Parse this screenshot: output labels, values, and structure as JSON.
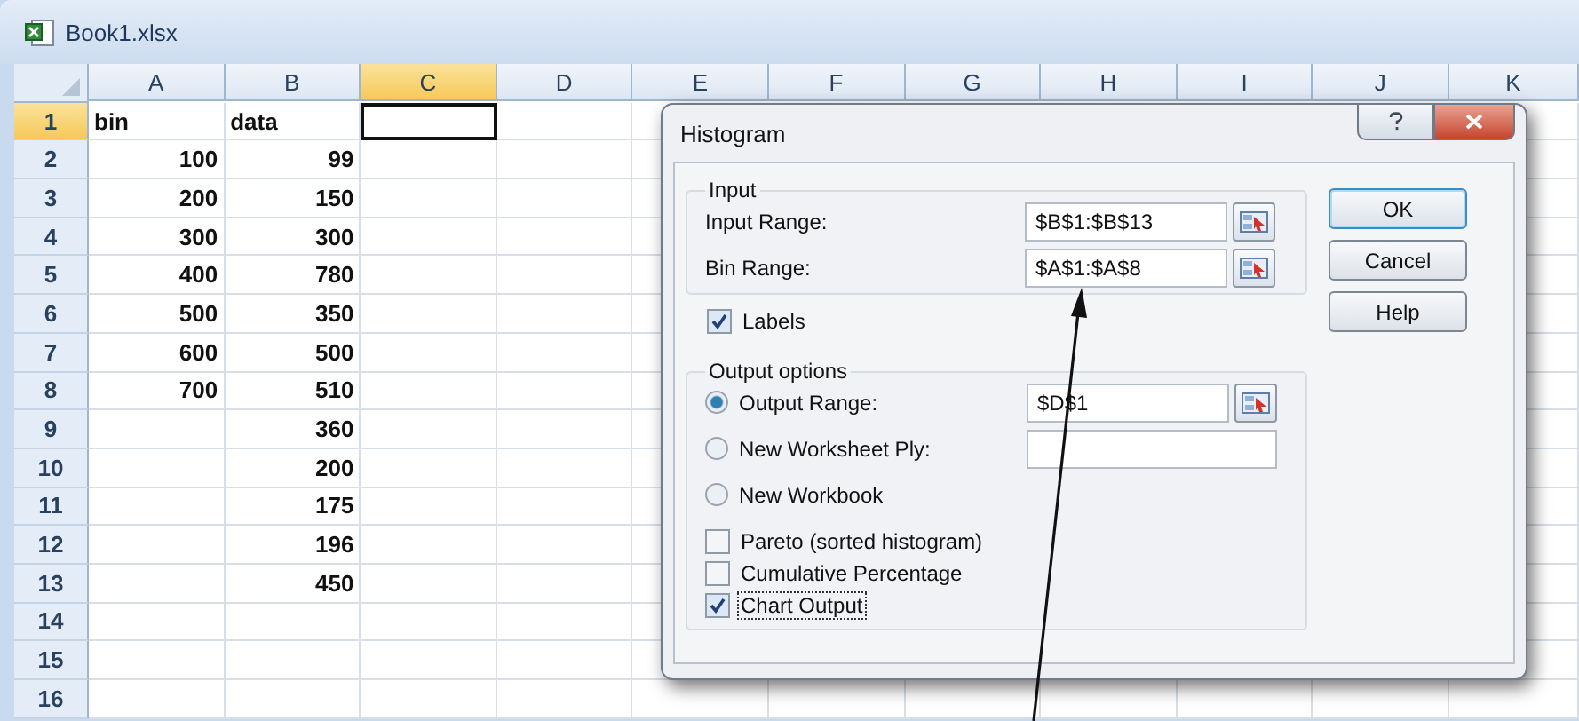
{
  "window": {
    "title": "Book1.xlsx"
  },
  "sheet": {
    "columns": [
      {
        "label": "A",
        "selected": false
      },
      {
        "label": "B",
        "selected": false
      },
      {
        "label": "C",
        "selected": true
      },
      {
        "label": "D",
        "selected": false
      },
      {
        "label": "E",
        "selected": false
      },
      {
        "label": "F",
        "selected": false
      },
      {
        "label": "G",
        "selected": false
      },
      {
        "label": "H",
        "selected": false
      },
      {
        "label": "I",
        "selected": false
      },
      {
        "label": "J",
        "selected": false
      },
      {
        "label": "K",
        "selected": false
      }
    ],
    "rows": [
      {
        "label": "1",
        "selected": true,
        "col_a": {
          "value": "bin",
          "kind": "text"
        },
        "col_b": {
          "value": "data",
          "kind": "text"
        }
      },
      {
        "label": "2",
        "selected": false,
        "col_a": {
          "value": "100",
          "kind": "number"
        },
        "col_b": {
          "value": "99",
          "kind": "number"
        }
      },
      {
        "label": "3",
        "selected": false,
        "col_a": {
          "value": "200",
          "kind": "number"
        },
        "col_b": {
          "value": "150",
          "kind": "number"
        }
      },
      {
        "label": "4",
        "selected": false,
        "col_a": {
          "value": "300",
          "kind": "number"
        },
        "col_b": {
          "value": "300",
          "kind": "number"
        }
      },
      {
        "label": "5",
        "selected": false,
        "col_a": {
          "value": "400",
          "kind": "number"
        },
        "col_b": {
          "value": "780",
          "kind": "number"
        }
      },
      {
        "label": "6",
        "selected": false,
        "col_a": {
          "value": "500",
          "kind": "number"
        },
        "col_b": {
          "value": "350",
          "kind": "number"
        }
      },
      {
        "label": "7",
        "selected": false,
        "col_a": {
          "value": "600",
          "kind": "number"
        },
        "col_b": {
          "value": "500",
          "kind": "number"
        }
      },
      {
        "label": "8",
        "selected": false,
        "col_a": {
          "value": "700",
          "kind": "number"
        },
        "col_b": {
          "value": "510",
          "kind": "number"
        }
      },
      {
        "label": "9",
        "selected": false,
        "col_b": {
          "value": "360",
          "kind": "number"
        }
      },
      {
        "label": "10",
        "selected": false,
        "col_b": {
          "value": "200",
          "kind": "number"
        }
      },
      {
        "label": "11",
        "selected": false,
        "col_b": {
          "value": "175",
          "kind": "number"
        }
      },
      {
        "label": "12",
        "selected": false,
        "col_b": {
          "value": "196",
          "kind": "number"
        }
      },
      {
        "label": "13",
        "selected": false,
        "col_b": {
          "value": "450",
          "kind": "number"
        }
      },
      {
        "label": "14",
        "selected": false
      },
      {
        "label": "15",
        "selected": false
      },
      {
        "label": "16",
        "selected": false
      }
    ]
  },
  "dialog": {
    "title": "Histogram",
    "input_group": {
      "title": "Input",
      "fields": [
        {
          "label": "Input Range:",
          "value": "$B$1:$B$13"
        },
        {
          "label": "Bin Range:",
          "value": "$A$1:$A$8"
        }
      ]
    },
    "labels_checkbox": {
      "label": "Labels",
      "checked": true,
      "focused": false
    },
    "output_group": {
      "title": "Output options",
      "options": [
        {
          "label": "Output Range:",
          "selected": true,
          "kind": "range",
          "value": "$D$1"
        },
        {
          "label": "New Worksheet Ply:",
          "selected": false,
          "kind": "field"
        },
        {
          "label": "New Workbook",
          "selected": false,
          "kind": "none"
        }
      ],
      "checkboxes": [
        {
          "label": "Pareto (sorted histogram)",
          "checked": false,
          "focused": false
        },
        {
          "label": "Cumulative Percentage",
          "checked": false,
          "focused": false
        },
        {
          "label": "Chart Output",
          "checked": true,
          "focused": true
        }
      ]
    },
    "buttons": [
      {
        "label": "OK",
        "default": true
      },
      {
        "label": "Cancel",
        "default": false
      },
      {
        "label": "Help",
        "default": false
      }
    ]
  }
}
